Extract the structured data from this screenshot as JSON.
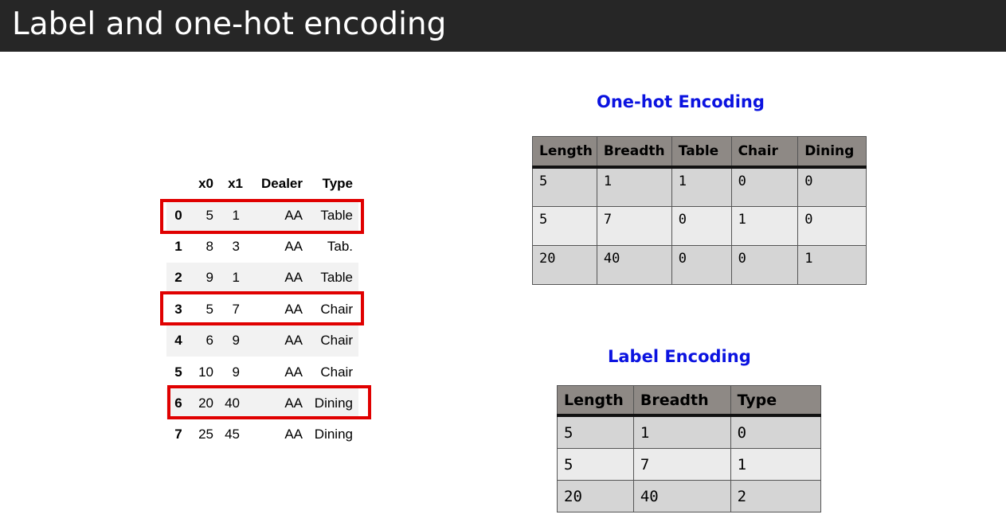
{
  "slide": {
    "title": "Label and one-hot encoding"
  },
  "left_table": {
    "columns": [
      "",
      "x0",
      "x1",
      "Dealer",
      "Type"
    ],
    "rows": [
      {
        "index": "0",
        "x0": "5",
        "x1": "1",
        "dealer": "AA",
        "type": "Table",
        "highlighted": true
      },
      {
        "index": "1",
        "x0": "8",
        "x1": "3",
        "dealer": "AA",
        "type": "Tab.",
        "highlighted": false
      },
      {
        "index": "2",
        "x0": "9",
        "x1": "1",
        "dealer": "AA",
        "type": "Table",
        "highlighted": false
      },
      {
        "index": "3",
        "x0": "5",
        "x1": "7",
        "dealer": "AA",
        "type": "Chair",
        "highlighted": true
      },
      {
        "index": "4",
        "x0": "6",
        "x1": "9",
        "dealer": "AA",
        "type": "Chair",
        "highlighted": false
      },
      {
        "index": "5",
        "x0": "10",
        "x1": "9",
        "dealer": "AA",
        "type": "Chair",
        "highlighted": false
      },
      {
        "index": "6",
        "x0": "20",
        "x1": "40",
        "dealer": "AA",
        "type": "Dining",
        "highlighted": true
      },
      {
        "index": "7",
        "x0": "25",
        "x1": "45",
        "dealer": "AA",
        "type": "Dining",
        "highlighted": false
      }
    ],
    "highlight_color": "#e00000"
  },
  "one_hot": {
    "heading": "One-hot Encoding",
    "columns": [
      "Length",
      "Breadth",
      "Table",
      "Chair",
      "Dining"
    ],
    "rows": [
      [
        "5",
        "1",
        "1",
        "0",
        "0"
      ],
      [
        "5",
        "7",
        "0",
        "1",
        "0"
      ],
      [
        "20",
        "40",
        "0",
        "0",
        "1"
      ]
    ]
  },
  "label_enc": {
    "heading": "Label Encoding",
    "columns": [
      "Length",
      "Breadth",
      "Type"
    ],
    "rows": [
      [
        "5",
        "1",
        "0"
      ],
      [
        "5",
        "7",
        "1"
      ],
      [
        "20",
        "40",
        "2"
      ]
    ]
  },
  "colors": {
    "title_bar": "#262626",
    "heading_blue": "#0b13e0",
    "header_gray": "#8e8985"
  }
}
